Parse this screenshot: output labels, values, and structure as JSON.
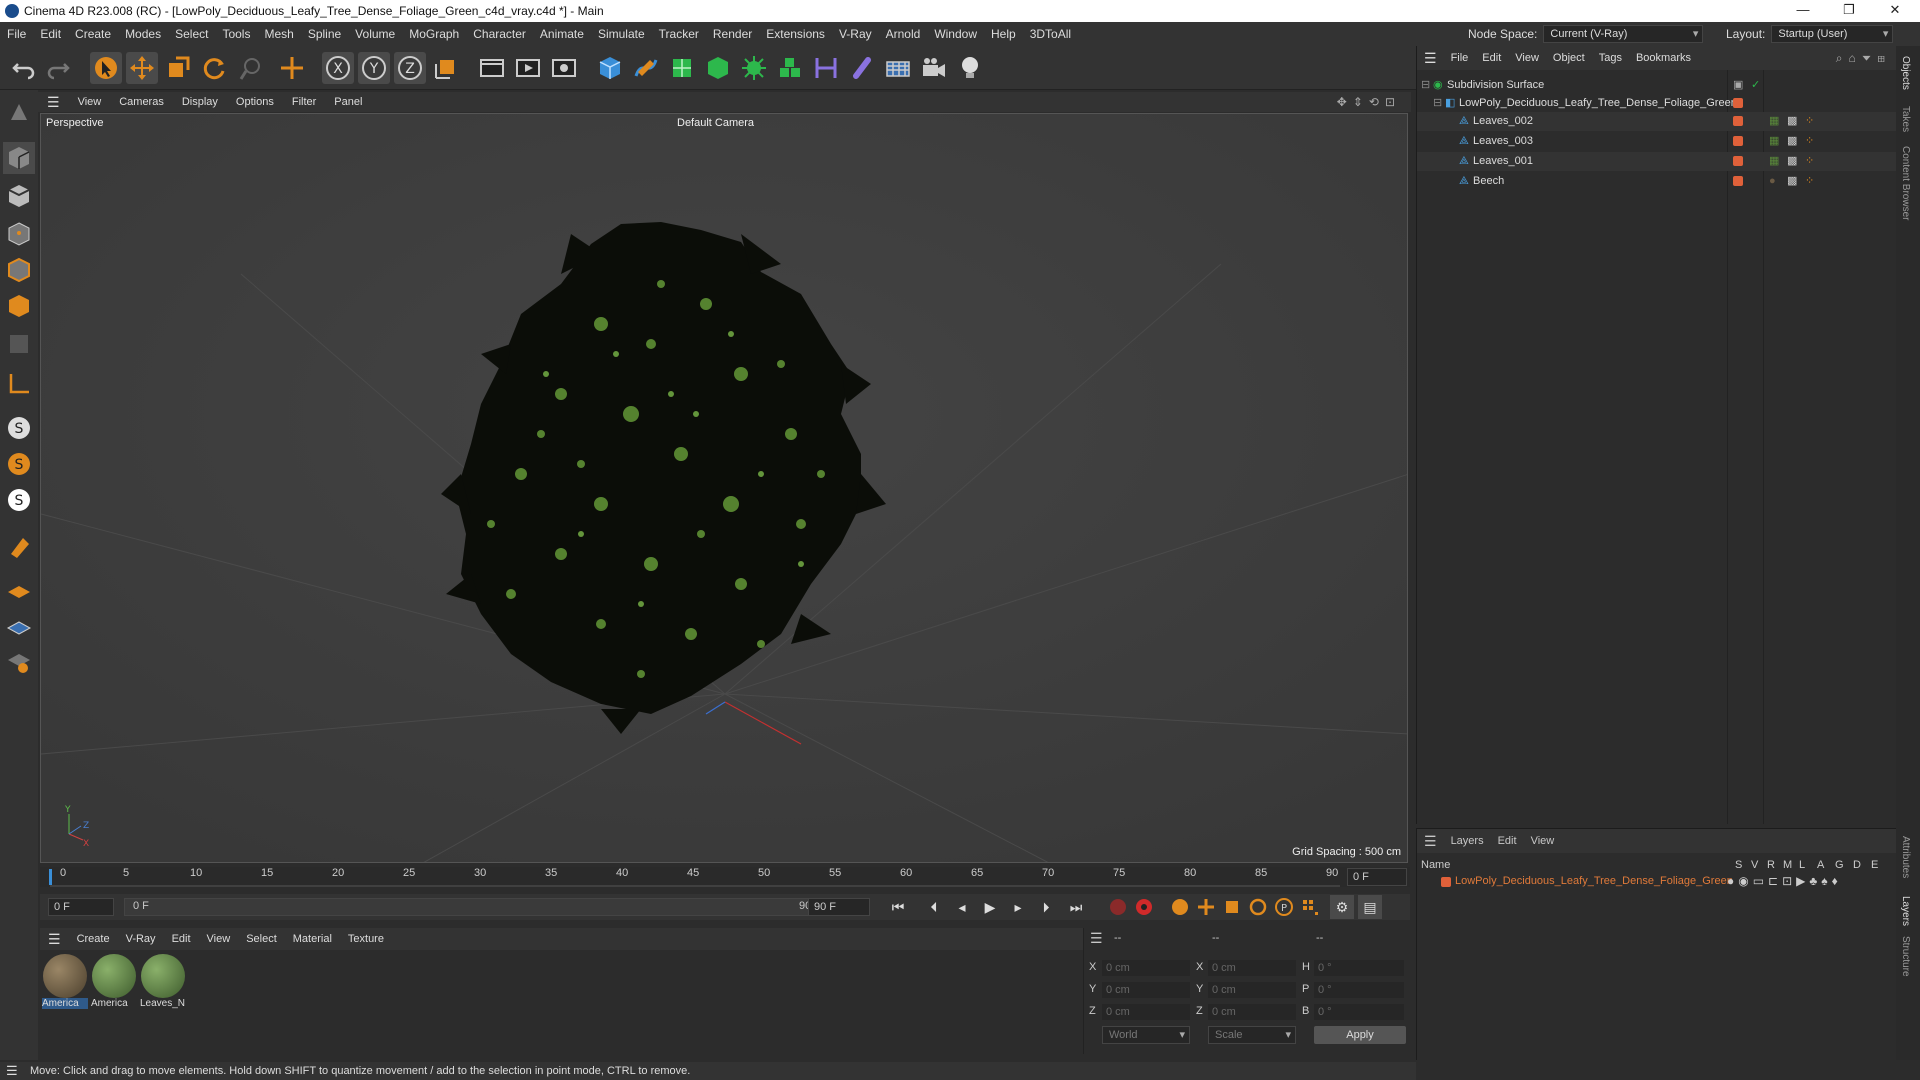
{
  "window": {
    "title": "Cinema 4D R23.008 (RC) - [LowPoly_Deciduous_Leafy_Tree_Dense_Foliage_Green_c4d_vray.c4d *] - Main"
  },
  "menu": [
    "File",
    "Edit",
    "Create",
    "Modes",
    "Select",
    "Tools",
    "Mesh",
    "Spline",
    "Volume",
    "MoGraph",
    "Character",
    "Animate",
    "Simulate",
    "Tracker",
    "Render",
    "Extensions",
    "V-Ray",
    "Arnold",
    "Window",
    "Help",
    "3DToAll"
  ],
  "node_space": {
    "label": "Node Space:",
    "value": "Current (V-Ray)"
  },
  "layout": {
    "label": "Layout:",
    "value": "Startup (User)"
  },
  "viewport": {
    "menu": [
      "View",
      "Cameras",
      "Display",
      "Options",
      "Filter",
      "Panel"
    ],
    "name": "Perspective",
    "camera": "Default Camera",
    "grid_spacing": "Grid Spacing : 500 cm"
  },
  "timeline": {
    "ticks": [
      "0",
      "5",
      "10",
      "15",
      "20",
      "25",
      "30",
      "35",
      "40",
      "45",
      "50",
      "55",
      "60",
      "65",
      "70",
      "75",
      "80",
      "85",
      "90"
    ],
    "end_field": "0 F",
    "current": "0 F",
    "range_start": "0 F",
    "range_end": "90 F",
    "max": "90 F"
  },
  "material_menu": [
    "Create",
    "V-Ray",
    "Edit",
    "View",
    "Select",
    "Material",
    "Texture"
  ],
  "materials": [
    {
      "label": "America",
      "color": "#6b5c44"
    },
    {
      "label": "America",
      "color": "#5d7a4c"
    },
    {
      "label": "Leaves_N",
      "color": "#5a7a48"
    }
  ],
  "coords": {
    "headers": [
      "--",
      "--",
      "--"
    ],
    "rows": [
      {
        "a": "X",
        "av": "0 cm",
        "b": "X",
        "bv": "0 cm",
        "c": "H",
        "cv": "0 °"
      },
      {
        "a": "Y",
        "av": "0 cm",
        "b": "Y",
        "bv": "0 cm",
        "c": "P",
        "cv": "0 °"
      },
      {
        "a": "Z",
        "av": "0 cm",
        "b": "Z",
        "bv": "0 cm",
        "c": "B",
        "cv": "0 °"
      }
    ],
    "space": "World",
    "mode": "Scale",
    "apply": "Apply"
  },
  "status": "Move: Click and drag to move elements. Hold down SHIFT to quantize movement / add to the selection in point mode, CTRL to remove.",
  "objects_menu": [
    "File",
    "Edit",
    "View",
    "Object",
    "Tags",
    "Bookmarks"
  ],
  "objects": [
    {
      "name": "Subdivision Surface"
    },
    {
      "name": "LowPoly_Deciduous_Leafy_Tree_Dense_Foliage_Green"
    },
    {
      "name": "Leaves_002"
    },
    {
      "name": "Leaves_003"
    },
    {
      "name": "Leaves_001"
    },
    {
      "name": "Beech"
    }
  ],
  "layers_menu": [
    "Layers",
    "Edit",
    "View"
  ],
  "layers": {
    "name_header": "Name",
    "cols": [
      "S",
      "V",
      "R",
      "M",
      "L",
      "A",
      "G",
      "D",
      "E"
    ],
    "row": "LowPoly_Deciduous_Leafy_Tree_Dense_Foliage_Green"
  },
  "right_tabs": [
    "Objects",
    "Takes",
    "Content Browser",
    "Attributes",
    "Layers",
    "Structure"
  ],
  "colors": {
    "accent": "#e0613a",
    "bg": "#2c2c2c",
    "layer_text": "#e07a3a"
  }
}
